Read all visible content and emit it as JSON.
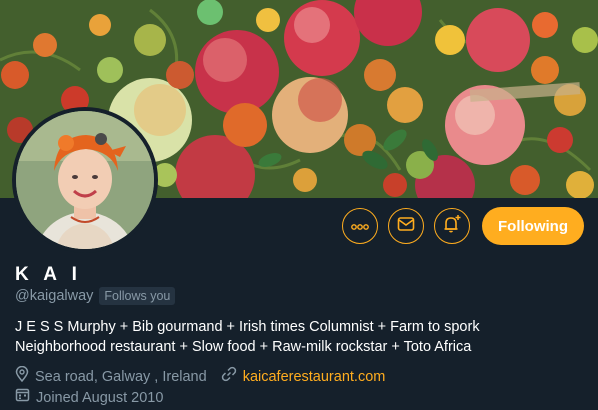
{
  "profile": {
    "name": "K A I",
    "handle": "@kaigalway",
    "follows_you": "Follows you",
    "bio_line1": "J E S S Murphy + Bib gourmand + Irish times Columnist + Farm to spork",
    "bio_line2": "Neighborhood restaurant + Slow food + Raw-milk rockstar + Toto Africa",
    "location": "Sea road, Galway , Ireland",
    "website": "kaicaferestaurant.com",
    "joined": "Joined August 2010"
  },
  "actions": {
    "following_label": "Following"
  },
  "icons": {
    "more": "more-icon",
    "message": "envelope-icon",
    "notifications": "bell-plus-icon",
    "location": "location-pin-icon",
    "link": "link-icon",
    "calendar": "calendar-icon"
  },
  "colors": {
    "accent": "#ffad1f",
    "background": "#15202b",
    "secondary_text": "#8899a6"
  }
}
